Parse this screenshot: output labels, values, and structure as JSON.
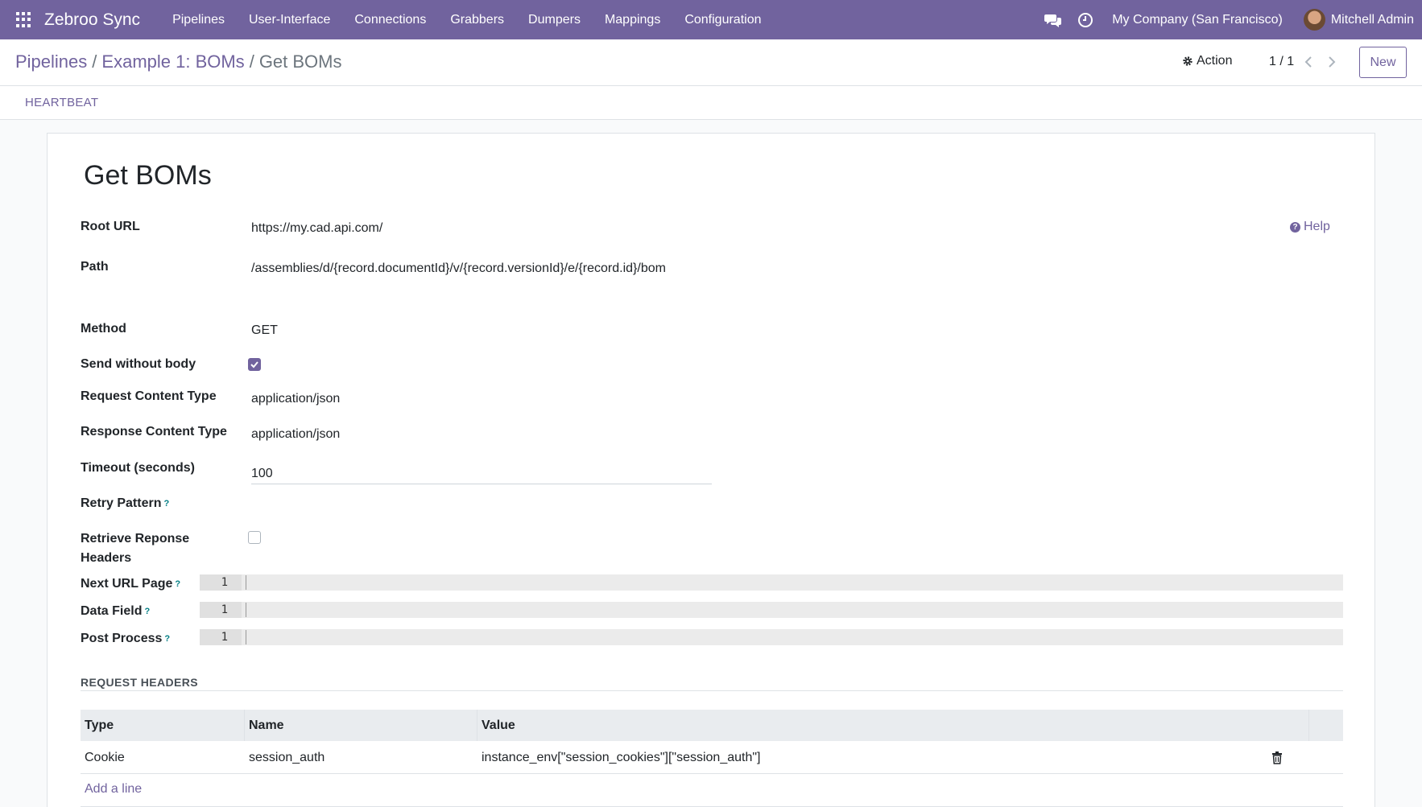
{
  "navbar": {
    "brand": "Zebroo Sync",
    "menu": [
      "Pipelines",
      "User-Interface",
      "Connections",
      "Grabbers",
      "Dumpers",
      "Mappings",
      "Configuration"
    ],
    "company": "My Company (San Francisco)",
    "user": "Mitchell Admin",
    "color": "#71639e"
  },
  "control_panel": {
    "breadcrumb": {
      "root": "Pipelines",
      "parent": "Example 1: BOMs",
      "current": "Get BOMs"
    },
    "action_label": "Action",
    "pager": "1 / 1",
    "new_label": "New"
  },
  "statusbar": {
    "heartbeat_label": "HEARTBEAT"
  },
  "form": {
    "title": "Get BOMs",
    "help_label": "Help",
    "fields": {
      "root_url": {
        "label": "Root URL",
        "value": "https://my.cad.api.com/"
      },
      "path": {
        "label": "Path",
        "value": "/assemblies/d/{record.documentId}/v/{record.versionId}/e/{record.id}/bom"
      },
      "method": {
        "label": "Method",
        "value": "GET"
      },
      "send_without_body": {
        "label": "Send without body",
        "checked": true
      },
      "request_content_type": {
        "label": "Request Content Type",
        "value": "application/json"
      },
      "response_content_type": {
        "label": "Response Content Type",
        "value": "application/json"
      },
      "timeout": {
        "label": "Timeout (seconds)",
        "value": "100"
      },
      "retry_pattern": {
        "label": "Retry Pattern",
        "tooltip": "?"
      },
      "retrieve_headers": {
        "label_line1": "Retrieve Reponse",
        "label_line2": "Headers",
        "checked": false
      },
      "next_url_page": {
        "label": "Next URL Page",
        "tooltip": "?",
        "line_number": "1"
      },
      "data_field": {
        "label": "Data Field",
        "tooltip": "?",
        "line_number": "1"
      },
      "post_process": {
        "label": "Post Process",
        "tooltip": "?",
        "line_number": "1"
      }
    },
    "request_headers": {
      "title": "REQUEST HEADERS",
      "columns": [
        "Type",
        "Name",
        "Value"
      ],
      "rows": [
        {
          "type": "Cookie",
          "name": "session_auth",
          "value": "instance_env[\"session_cookies\"][\"session_auth\"]"
        }
      ],
      "add_line_label": "Add a line"
    }
  }
}
